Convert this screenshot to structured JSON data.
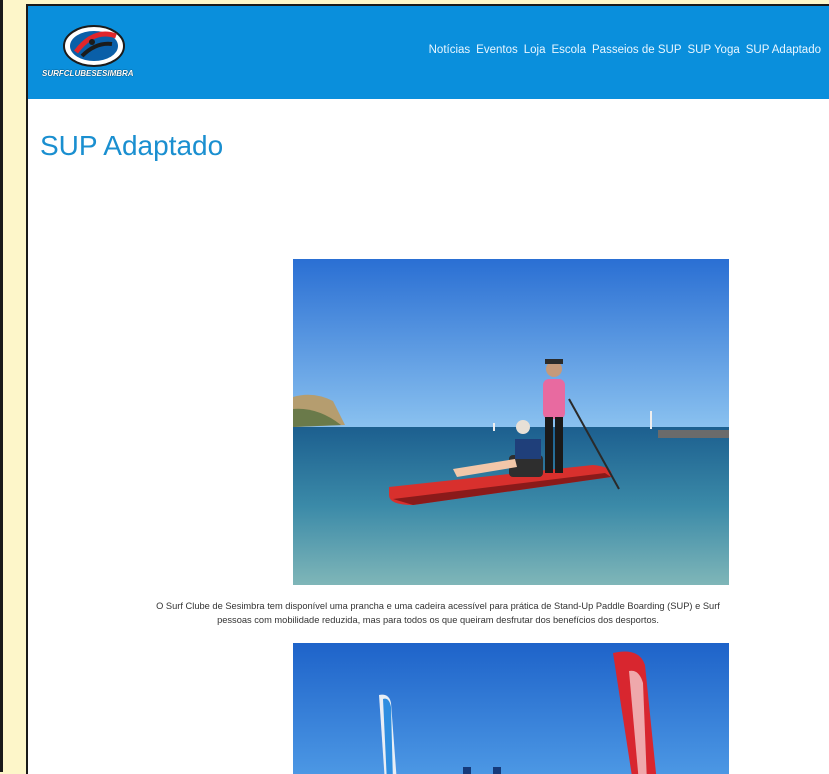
{
  "brand": {
    "logo_text": "SURFCLUBESESIMBRA",
    "colors": {
      "header": "#0a8fdc",
      "title": "#1a8fd0",
      "logo_accent": "#e0262b"
    }
  },
  "nav": {
    "items": [
      "Notícias",
      "Eventos",
      "Loja",
      "Escola",
      "Passeios de SUP",
      "SUP Yoga",
      "SUP Adaptado"
    ]
  },
  "page": {
    "title": "SUP Adaptado",
    "caption_line1": "O Surf Clube de Sesimbra tem disponível uma prancha e uma cadeira acessível para prática de Stand-Up Paddle Boarding (SUP) e Surf",
    "caption_line2": "pessoas com mobilidade reduzida, mas para todos os que queiram desfrutar dos benefícios dos desportos."
  },
  "images": {
    "photo1": "photo: person seated in accessible chair on red inflatable paddle board with standing paddler, sea and coastline",
    "photo2": "photo: blue sky with beach feather flags"
  }
}
